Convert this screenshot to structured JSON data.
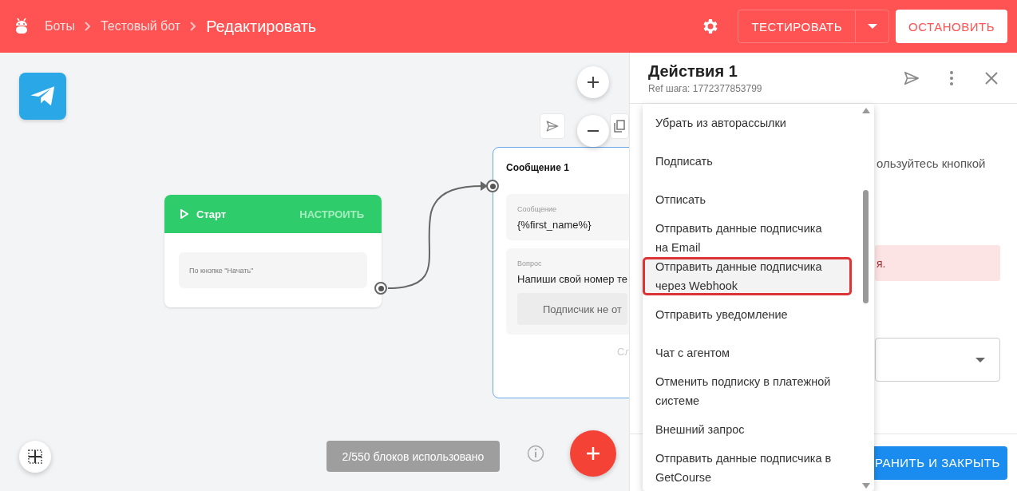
{
  "header": {
    "breadcrumbs": [
      {
        "label": "Боты"
      },
      {
        "label": "Тестовый бот"
      }
    ],
    "title": "Редактировать",
    "test_button": "ТЕСТИРОВАТЬ",
    "stop_button": "ОСТАНОВИТЬ"
  },
  "canvas": {
    "start_node": {
      "title": "Старт",
      "action": "НАСТРОИТЬ",
      "trigger": "По кнопке \"Начать\""
    },
    "message_node": {
      "title": "Сообщение 1",
      "selected": true,
      "blocks": [
        {
          "kind": "text",
          "label": "Сообщение",
          "text": "{%first_name%}"
        },
        {
          "kind": "question",
          "label": "Вопрос",
          "text": "Напиши свой номер те",
          "button": "Подписчик не от"
        }
      ],
      "footer": "Сл"
    },
    "usage_badge": "2/550 блоков использовано"
  },
  "panel": {
    "title": "Действия 1",
    "ref": "Ref шага: 1772377853799",
    "hint": "ользуйтесь кнопкой",
    "alert": "я.",
    "save_button": "РАНИТЬ И ЗАКРЫТЬ"
  },
  "dropdown": {
    "items": [
      {
        "label": "Убрать из авторассылки",
        "selected": false
      },
      {
        "label": "Подписать",
        "selected": false
      },
      {
        "label": "Отписать",
        "selected": false
      },
      {
        "label": "Отправить данные подписчика на Email",
        "selected": false
      },
      {
        "label": "Отправить данные подписчика через Webhook",
        "selected": true
      },
      {
        "label": "Отправить уведомление",
        "selected": false
      },
      {
        "label": "Чат с агентом",
        "selected": false
      },
      {
        "label": "Отменить подписку в платежной системе",
        "selected": false
      },
      {
        "label": "Внешний запрос",
        "selected": false
      },
      {
        "label": "Отправить данные подписчика в GetCourse",
        "selected": false
      }
    ]
  }
}
